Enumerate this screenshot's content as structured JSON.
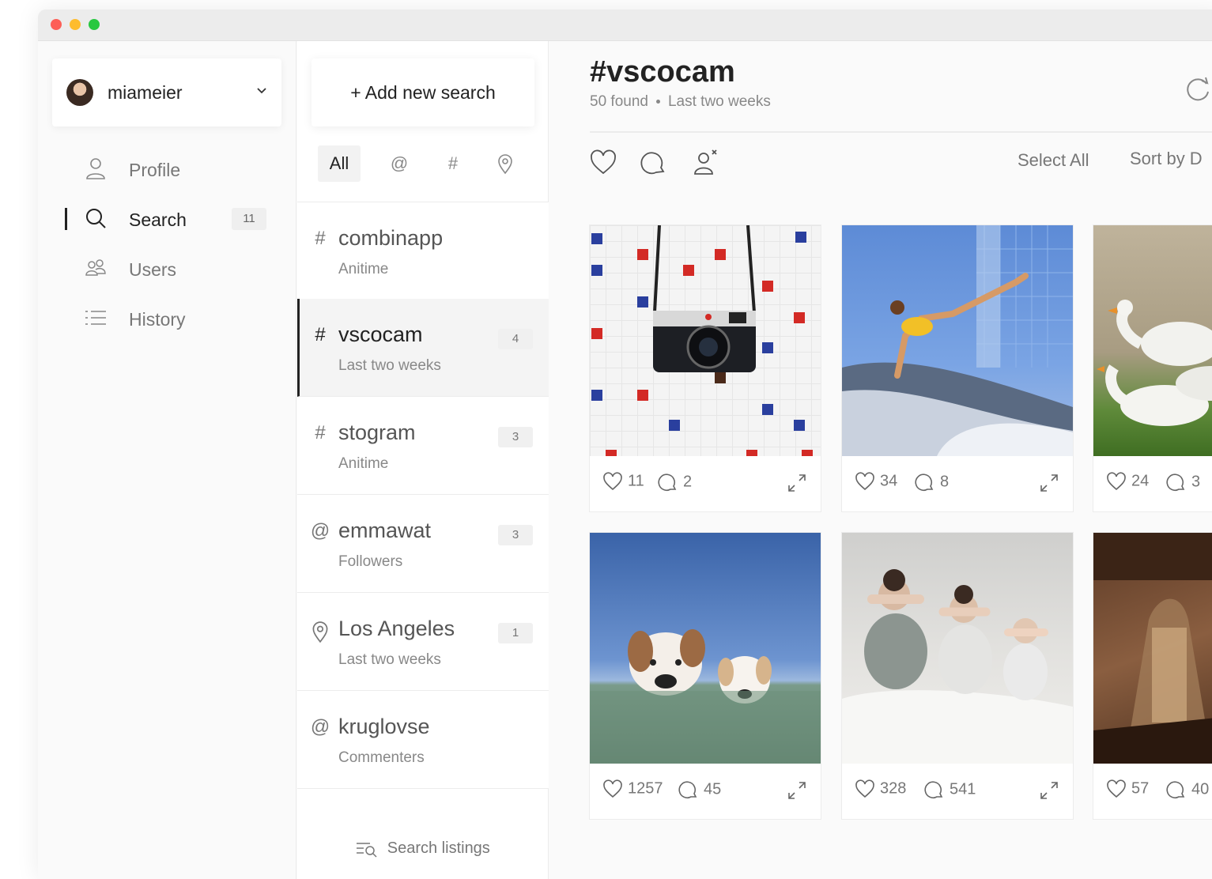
{
  "account": {
    "username": "miameier"
  },
  "sidebar": {
    "items": [
      {
        "label": "Profile",
        "icon": "user-icon"
      },
      {
        "label": "Search",
        "icon": "search-icon",
        "badge": "11",
        "active": true
      },
      {
        "label": "Users",
        "icon": "users-icon"
      },
      {
        "label": "History",
        "icon": "list-icon"
      }
    ]
  },
  "searches": {
    "add_label": "+ Add new search",
    "filters": [
      "All",
      "@",
      "#"
    ],
    "items": [
      {
        "symbol": "#",
        "title": "combinapp",
        "subtitle": "Anitime",
        "count": ""
      },
      {
        "symbol": "#",
        "title": "vscocam",
        "subtitle": "Last two weeks",
        "count": "4",
        "active": true
      },
      {
        "symbol": "#",
        "title": "stogram",
        "subtitle": "Anitime",
        "count": "3"
      },
      {
        "symbol": "@",
        "title": "emmawat",
        "subtitle": "Followers",
        "count": "3"
      },
      {
        "symbol": "pin",
        "title": "Los Angeles",
        "subtitle": "Last two weeks",
        "count": "1"
      },
      {
        "symbol": "@",
        "title": "kruglovse",
        "subtitle": "Commenters",
        "count": ""
      }
    ],
    "footer_label": "Search listings"
  },
  "main": {
    "title": "#vscocam",
    "found": "50 found",
    "period": "Last two weeks",
    "select_all": "Select All",
    "sort_by": "Sort by D"
  },
  "posts": [
    {
      "likes": "11",
      "comments": "2"
    },
    {
      "likes": "34",
      "comments": "8"
    },
    {
      "likes": "24",
      "comments": "3"
    },
    {
      "likes": "1257",
      "comments": "45"
    },
    {
      "likes": "328",
      "comments": "541"
    },
    {
      "likes": "57",
      "comments": "40"
    }
  ],
  "colors": {
    "accent": "#222222",
    "muted": "#777777",
    "window_red": "#fd5f57",
    "window_yellow": "#febc2e",
    "window_green": "#28c840"
  }
}
